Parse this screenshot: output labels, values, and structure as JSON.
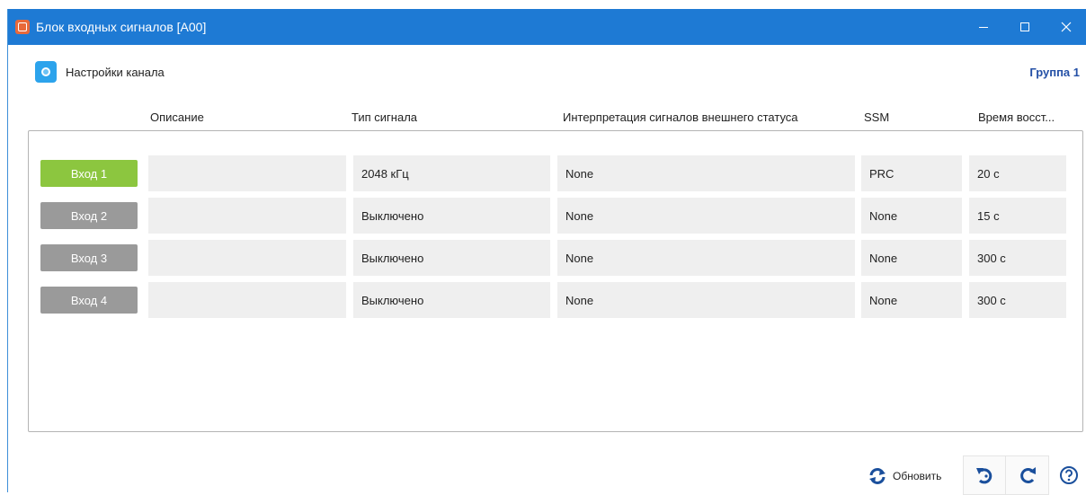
{
  "window": {
    "title": "Блок входных сигналов [A00]",
    "accent_color": "#1e7ad4",
    "controls": [
      "minimize-icon",
      "maximize-icon",
      "close-icon"
    ]
  },
  "toolbar": {
    "channel_settings_label": "Настройки канала",
    "group_label": "Группа 1"
  },
  "table": {
    "columns": [
      "Описание",
      "Тип сигнала",
      "Интерпретация сигналов внешнего статуса",
      "SSM",
      "Время восст..."
    ],
    "rows": [
      {
        "input": "Вход 1",
        "active": true,
        "description": "",
        "signal_type": "2048 кГц",
        "interpretation": "None",
        "ssm": "PRC",
        "restore_time": "20 с"
      },
      {
        "input": "Вход 2",
        "active": false,
        "description": "",
        "signal_type": "Выключено",
        "interpretation": "None",
        "ssm": "None",
        "restore_time": "15 с"
      },
      {
        "input": "Вход 3",
        "active": false,
        "description": "",
        "signal_type": "Выключено",
        "interpretation": "None",
        "ssm": "None",
        "restore_time": "300 с"
      },
      {
        "input": "Вход 4",
        "active": false,
        "description": "",
        "signal_type": "Выключено",
        "interpretation": "None",
        "ssm": "None",
        "restore_time": "300 с"
      }
    ],
    "active_color": "#8cc63f",
    "inactive_color": "#9a9a9a"
  },
  "footer": {
    "refresh_label": "Обновить",
    "icons": [
      "refresh-icon",
      "undo-icon",
      "redo-icon",
      "help-icon"
    ]
  }
}
